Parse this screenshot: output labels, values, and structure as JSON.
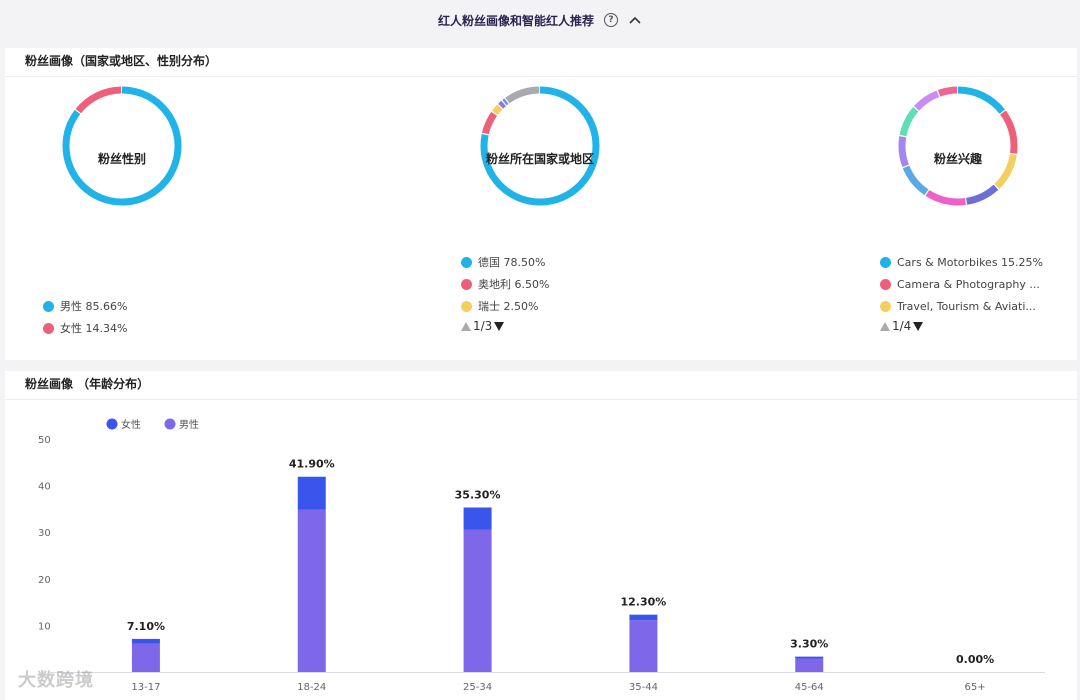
{
  "header": {
    "title": "红人粉丝画像和智能红人推荐"
  },
  "fan_profile": {
    "title": "粉丝画像（国家或地区、性别分布）",
    "gender": {
      "label": "粉丝性别",
      "items": [
        {
          "name": "男性",
          "percent": "85.66%",
          "value": 85.66,
          "color": "#1fb3e8"
        },
        {
          "name": "女性",
          "percent": "14.34%",
          "value": 14.34,
          "color": "#ee6079"
        }
      ]
    },
    "country": {
      "label": "粉丝所在国家或地区",
      "items": [
        {
          "name": "德国",
          "percent": "78.50%",
          "value": 78.5,
          "color": "#1fb3e8"
        },
        {
          "name": "奥地利",
          "percent": "6.50%",
          "value": 6.5,
          "color": "#ee6079"
        },
        {
          "name": "瑞士",
          "percent": "2.50%",
          "value": 2.5,
          "color": "#f4cf5f"
        }
      ],
      "extra_segments": [
        {
          "value": 1.5,
          "color": "#8e74e8"
        },
        {
          "value": 1.0,
          "color": "#5f8fe0"
        },
        {
          "value": 10.0,
          "color": "#a9a9b2"
        }
      ],
      "page": "1/3"
    },
    "interest": {
      "label": "粉丝兴趣",
      "items": [
        {
          "name": "Cars & Motorbikes 15.25%",
          "value": 15.25,
          "color": "#1fb3e8"
        },
        {
          "name": "Camera & Photography ...",
          "value": 13,
          "color": "#ee6079"
        },
        {
          "name": "Travel, Tourism & Aviati...",
          "value": 11,
          "color": "#f4cf5f"
        }
      ],
      "extra_segments": [
        {
          "value": 10,
          "color": "#6e6fd4"
        },
        {
          "value": 12,
          "color": "#ee62c8"
        },
        {
          "value": 10,
          "color": "#5aa9e6"
        },
        {
          "value": 9,
          "color": "#a585ee"
        },
        {
          "value": 9,
          "color": "#5ee0b4"
        },
        {
          "value": 8,
          "color": "#c98cf0"
        },
        {
          "value": 5.75,
          "color": "#f06491"
        }
      ],
      "page": "1/4"
    }
  },
  "age_profile": {
    "title": "粉丝画像 （年龄分布）"
  },
  "chart_data": {
    "type": "bar",
    "stacked": true,
    "categories": [
      "13-17",
      "18-24",
      "25-34",
      "35-44",
      "45-64",
      "65+"
    ],
    "series": [
      {
        "name": "女性",
        "color": "#3a55ec",
        "values": [
          1.0,
          7.1,
          4.8,
          1.2,
          0.4,
          0
        ]
      },
      {
        "name": "男性",
        "color": "#7f67ea",
        "values": [
          6.1,
          34.8,
          30.5,
          11.1,
          2.9,
          0
        ]
      }
    ],
    "totals_labels": [
      "7.10%",
      "41.90%",
      "35.30%",
      "12.30%",
      "3.30%",
      "0.00%"
    ],
    "y_ticks": [
      10,
      20,
      30,
      40,
      50
    ],
    "ylim": [
      0,
      50
    ],
    "legend": "top-left"
  },
  "watermark": "大数跨境"
}
